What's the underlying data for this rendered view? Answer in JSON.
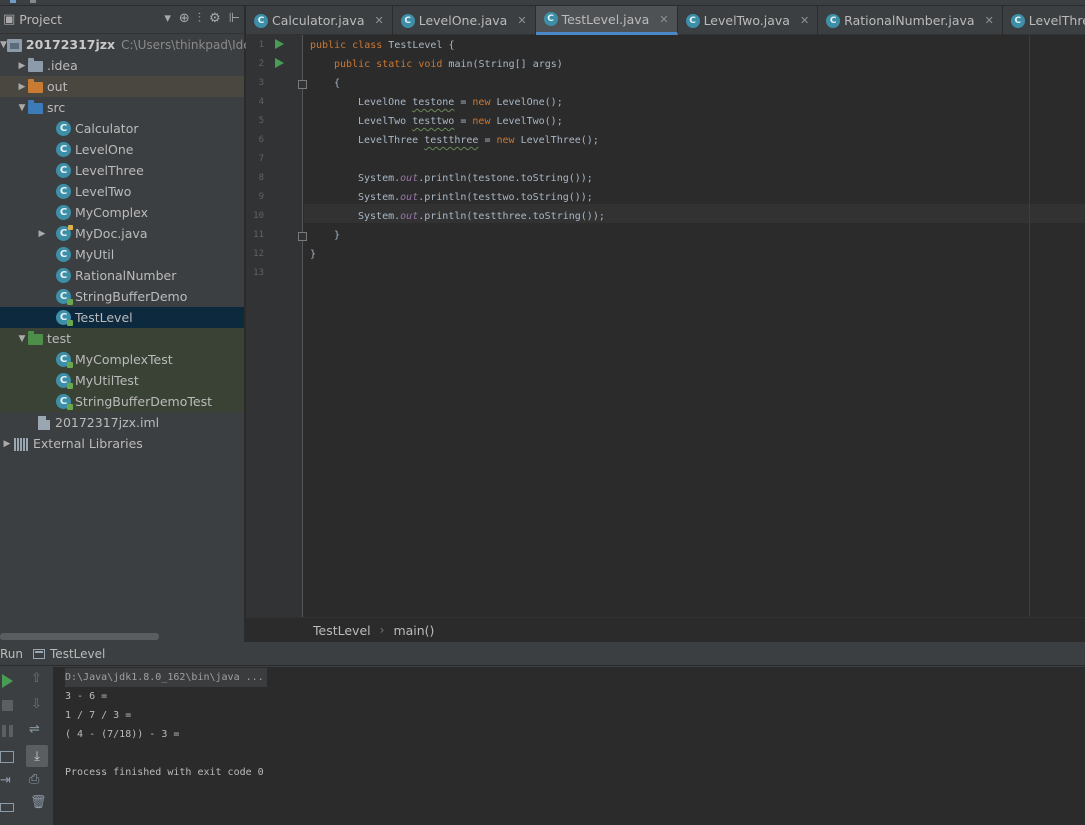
{
  "project_panel": {
    "title": "Project",
    "tree": {
      "root_name": "20172317jzx",
      "root_path": "C:\\Users\\thinkpad\\Idea",
      "idea": ".idea",
      "out": "out",
      "src": "src",
      "src_items": [
        "Calculator",
        "LevelOne",
        "LevelThree",
        "LevelTwo",
        "MyComplex",
        "MyDoc.java",
        "MyUtil",
        "RationalNumber",
        "StringBufferDemo",
        "TestLevel"
      ],
      "test": "test",
      "test_items": [
        "MyComplexTest",
        "MyUtilTest",
        "StringBufferDemoTest"
      ],
      "iml": "20172317jzx.iml",
      "libraries": "External Libraries"
    }
  },
  "editor": {
    "tabs": [
      "Calculator.java",
      "LevelOne.java",
      "TestLevel.java",
      "LevelTwo.java",
      "RationalNumber.java",
      "LevelThree.java"
    ],
    "active_tab": "TestLevel.java",
    "line_numbers": [
      "1",
      "2",
      "3",
      "4",
      "5",
      "6",
      "7",
      "8",
      "9",
      "10",
      "11",
      "12",
      "13"
    ],
    "code": {
      "l1_kw1": "public",
      "l1_kw2": "class",
      "l1_rest": " TestLevel {",
      "l2_kw1": "public",
      "l2_kw2": "static",
      "l2_kw3": "void",
      "l2_rest": " main(String[] args)",
      "l3": "{",
      "l4_type": "LevelOne ",
      "l4_var": "testone",
      "l4_eq": " = ",
      "l4_new": "new",
      "l4_ctor": " LevelOne();",
      "l5_type": "LevelTwo ",
      "l5_var": "testtwo",
      "l5_eq": " = ",
      "l5_new": "new",
      "l5_ctor": " LevelTwo();",
      "l6_type": "LevelThree ",
      "l6_var": "testthree",
      "l6_eq": " = ",
      "l6_new": "new",
      "l6_ctor": " LevelThree();",
      "sys": "System.",
      "out": "out",
      "l8_rest": ".println(testone.toString());",
      "l9_rest": ".println(testtwo.toString());",
      "l10_rest": ".println(testthree.toString());",
      "l11": "}",
      "l12": "}"
    },
    "breadcrumb": [
      "TestLevel",
      "main()"
    ]
  },
  "run_panel": {
    "label": "Run",
    "config": "TestLevel",
    "console": [
      "D:\\Java\\jdk1.8.0_162\\bin\\java ...",
      "3 - 6 =",
      "1 / 7 / 3 =",
      "( 4 - (7/18)) - 3 =",
      "",
      "Process finished with exit code 0"
    ]
  },
  "colors": {
    "keyword": "#cc7832",
    "static_field": "#9876aa",
    "plain_code": "#a9b7c6",
    "selection": "#0d293e",
    "class_icon": "#3d8fa8",
    "run_green": "#499c54"
  }
}
